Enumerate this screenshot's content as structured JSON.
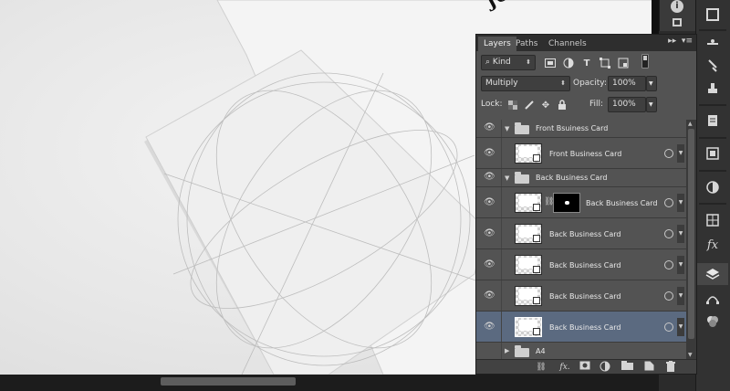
{
  "canvas": {
    "card_text": "Johan"
  },
  "panel_tabs": [
    "Layers",
    "Paths",
    "Channels"
  ],
  "filter": {
    "kind_label": "Kind",
    "icons": [
      "image-filter-icon",
      "adjustment-filter-icon",
      "type-filter-icon",
      "shape-filter-icon",
      "smart-object-filter-icon",
      "filter-toggle-icon"
    ]
  },
  "blend": {
    "mode": "Multiply",
    "opacity_label": "Opacity:",
    "opacity_value": "100%",
    "lock_label": "Lock:",
    "fill_label": "Fill:",
    "fill_value": "100%"
  },
  "layers": [
    {
      "type": "group",
      "name": "Front Bsuiness Card",
      "expanded": true
    },
    {
      "type": "layer",
      "name": "Front Business Card",
      "mask": false,
      "selected": false
    },
    {
      "type": "group",
      "name": "Back Business Card",
      "expanded": true
    },
    {
      "type": "layer",
      "name": "Back Business Card",
      "mask": true,
      "selected": false
    },
    {
      "type": "layer",
      "name": "Back Business Card",
      "mask": false,
      "selected": false
    },
    {
      "type": "layer",
      "name": "Back Business Card",
      "mask": false,
      "selected": false
    },
    {
      "type": "layer",
      "name": "Back Business Card",
      "mask": false,
      "selected": false
    },
    {
      "type": "layer",
      "name": "Back Business Card",
      "mask": false,
      "selected": true
    },
    {
      "type": "group",
      "name": "A4",
      "expanded": false
    }
  ],
  "footer_icons": [
    "link-layers-icon",
    "fx-icon",
    "add-mask-icon",
    "adjustment-layer-icon",
    "new-group-icon",
    "new-layer-icon",
    "delete-layer-icon"
  ],
  "dock_icons": [
    "adjustments-icon",
    "brush-presets-icon",
    "clone-source-icon",
    "notes-icon",
    "libraries-icon",
    "color-icon",
    "swatches-icon",
    "styles-icon",
    "layers-icon",
    "paths-icon",
    "channels-icon"
  ]
}
